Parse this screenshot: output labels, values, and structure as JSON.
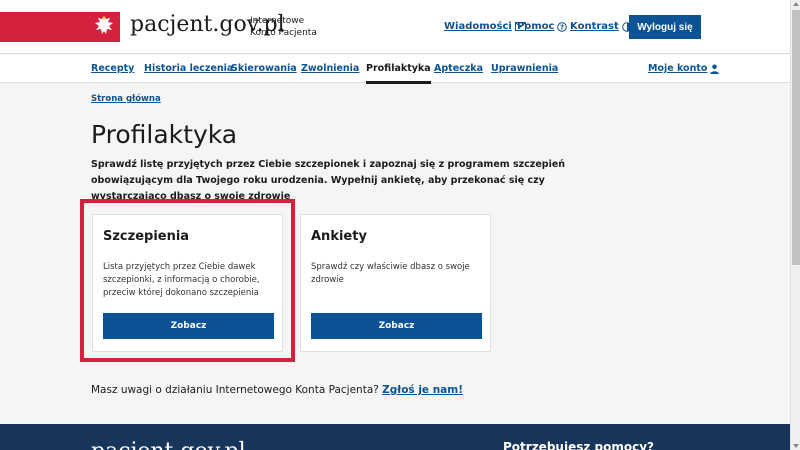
{
  "header": {
    "logo": "pacjent.gov.pl",
    "subtitle": "Internetowe Konto Pacjenta",
    "links": {
      "messages": "Wiadomości",
      "help": "Pomoc",
      "contrast": "Kontrast"
    },
    "logout": "Wyloguj się"
  },
  "nav": {
    "items": [
      "Recepty",
      "Historia leczenia",
      "Skierowania",
      "Zwolnienia",
      "Profilaktyka",
      "Apteczka",
      "Uprawnienia"
    ],
    "active": "Profilaktyka",
    "account": "Moje konto"
  },
  "breadcrumb": "Strona główna",
  "page": {
    "title": "Profilaktyka",
    "intro": "Sprawdź listę przyjętych przez Ciebie szczepionek i zapoznaj się z programem szczepień obowiązującym dla Twojego roku urodzenia. Wypełnij ankietę, aby przekonać się czy wystarczająco dbasz o swoje zdrowie"
  },
  "cards": [
    {
      "title": "Szczepienia",
      "desc": "Lista przyjętych przez Ciebie dawek szczepionki, z informacją o chorobie, przeciw której dokonano szczepienia",
      "button": "Zobacz"
    },
    {
      "title": "Ankiety",
      "desc": "Sprawdź czy właściwie dbasz o swoje zdrowie",
      "button": "Zobacz"
    }
  ],
  "feedback": {
    "text": "Masz uwagi o działaniu Internetowego Konta Pacjenta?",
    "link": "Zgłoś je nam!"
  },
  "footer": {
    "logo": "pacjent.gov.pl",
    "help": "Potrzebujesz pomocy?"
  },
  "colors": {
    "brand_red": "#d4213d",
    "primary_blue": "#0b5394",
    "footer_navy": "#18365c"
  }
}
